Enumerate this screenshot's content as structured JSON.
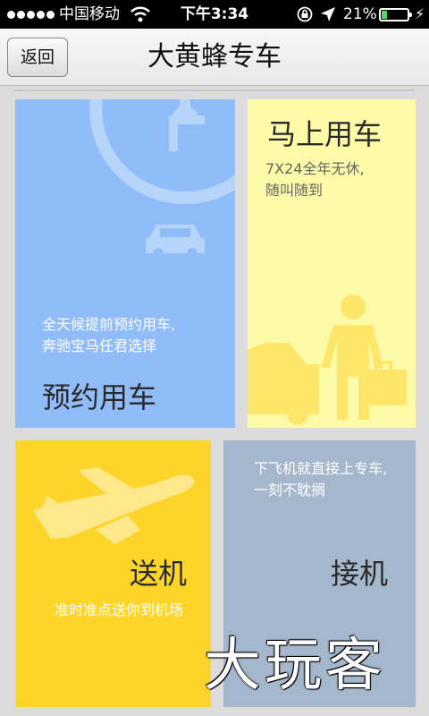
{
  "status_bar": {
    "carrier": "中国移动",
    "time": "下午3:34",
    "battery": "21%",
    "colors": {
      "battery_fill": "#4cd964"
    }
  },
  "nav": {
    "back_label": "返回",
    "title": "大黄蜂专车"
  },
  "tiles": {
    "reserve": {
      "title": "预约用车",
      "desc_line1": "全天候提前预约用车,",
      "desc_line2": "奔驰宝马任君选择",
      "color": "#90bdfa"
    },
    "now": {
      "title": "马上用车",
      "desc_line1": "7X24全年无休,",
      "desc_line2": "随叫随到",
      "color": "#fdfba7"
    },
    "send": {
      "title": "送机",
      "desc": "准时准点送你到机场",
      "color": "#fdd52a"
    },
    "pick": {
      "title": "接机",
      "desc_line1": "下飞机就直接上专车,",
      "desc_line2": "一刻不耽搁",
      "color": "#a5b7cc"
    }
  },
  "watermark": "大玩客"
}
